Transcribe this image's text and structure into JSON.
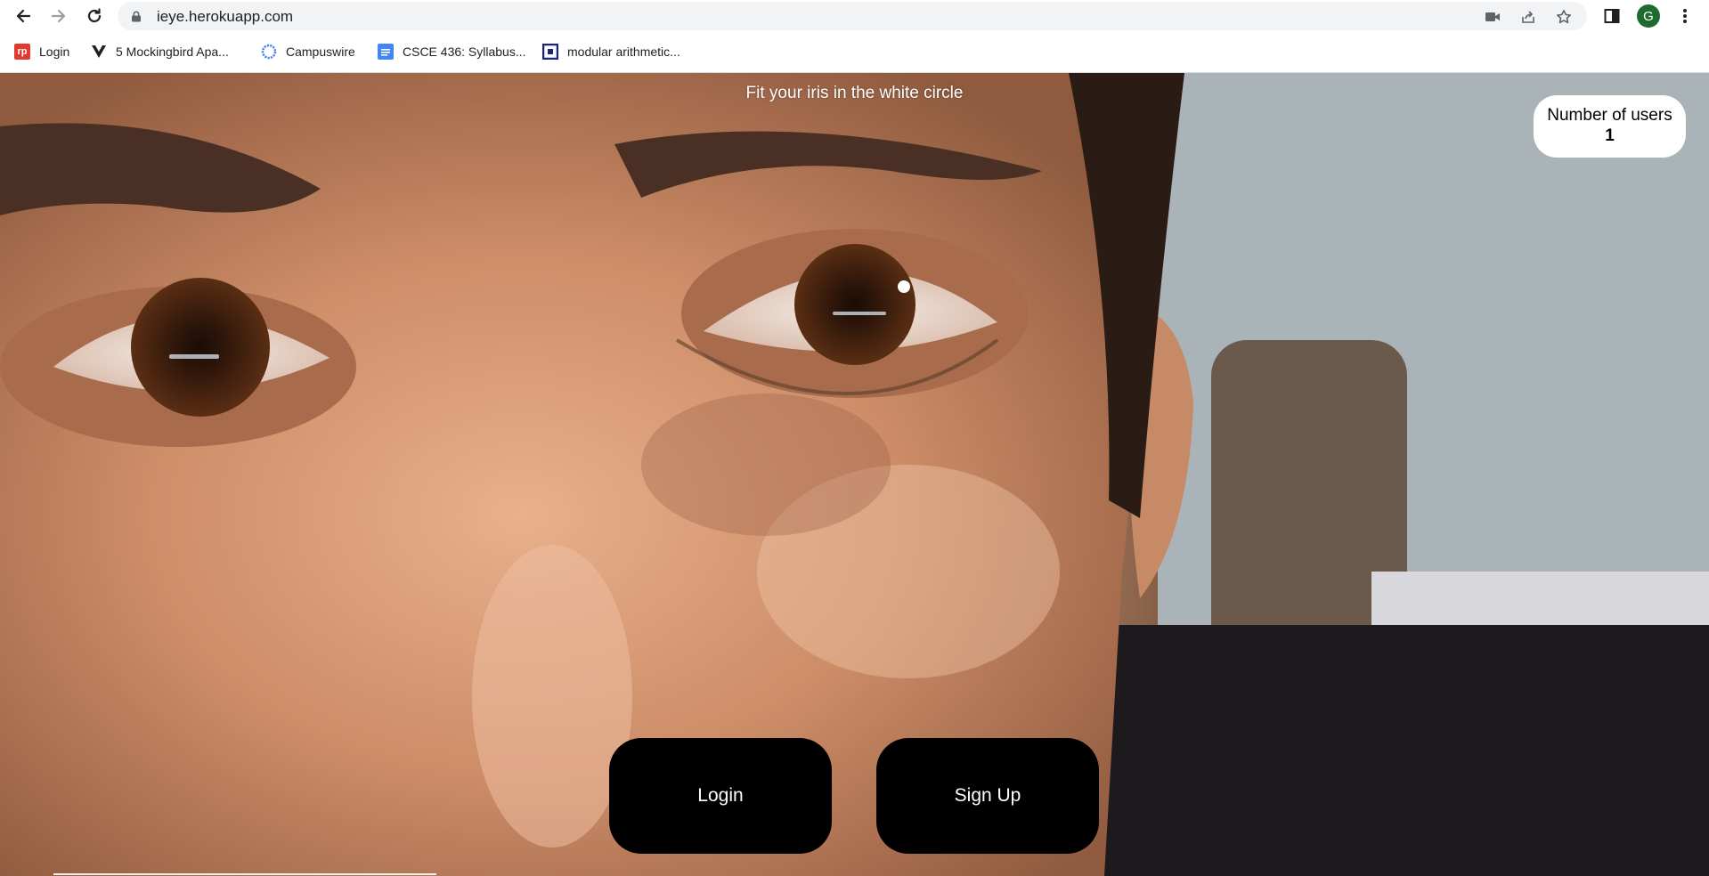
{
  "browser": {
    "url": "ieye.herokuapp.com",
    "profile_initial": "G",
    "icons": {
      "back": "arrow-left",
      "forward": "arrow-right",
      "reload": "refresh",
      "lock": "lock",
      "camera": "video-camera",
      "share": "share",
      "bookmark_star": "star",
      "side_panel": "side-panel",
      "menu": "kebab-menu"
    }
  },
  "bookmarks": [
    {
      "label": "Login",
      "icon": "rp-logo"
    },
    {
      "label": "5 Mockingbird Apa...",
      "icon": "chevron-v-logo"
    },
    {
      "label": "Campuswire",
      "icon": "campuswire-logo"
    },
    {
      "label": "CSCE 436: Syllabus...",
      "icon": "google-docs"
    },
    {
      "label": "modular arithmetic...",
      "icon": "bracket-logo"
    }
  ],
  "page": {
    "instruction": "Fit your iris in the white circle",
    "users_label": "Number of users",
    "users_count": "1",
    "login_label": "Login",
    "signup_label": "Sign Up",
    "colors": {
      "button_bg": "#000000",
      "button_text": "#ffffff",
      "card_bg": "#ffffff",
      "instruction_text": "#ffffff"
    }
  }
}
